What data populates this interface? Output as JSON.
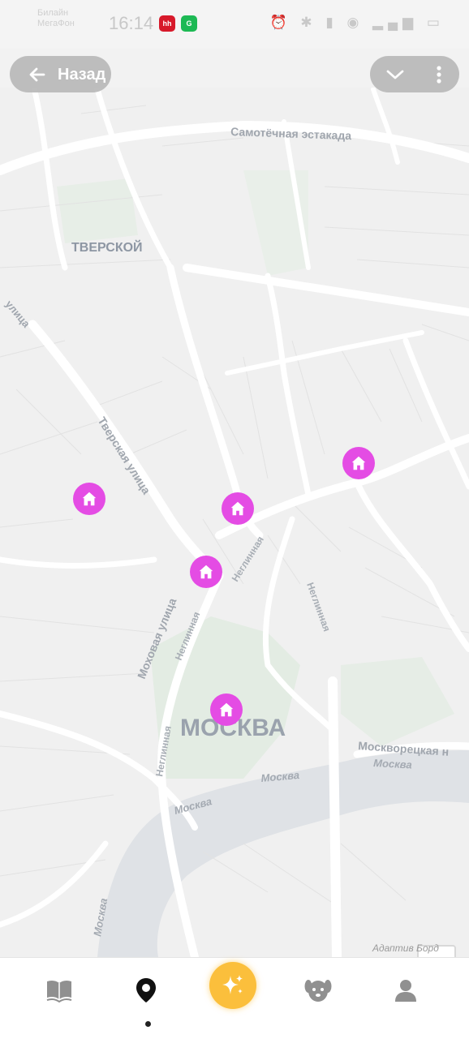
{
  "status_bar": {
    "carrier_line1": "Билайн",
    "carrier_line2": "МегаФон",
    "time": "16:14",
    "app_badges": [
      {
        "icon": "hh-app-icon",
        "text": "hh",
        "color": "#d7192a"
      },
      {
        "icon": "green-app-icon",
        "text": "G",
        "color": "#1db954"
      }
    ],
    "sys_icons": "⏰ ✱ ▮ ◉ ▂▄▆ ▭"
  },
  "header": {
    "back_label": "Назад",
    "back_icon": "arrow-left-icon",
    "collapse_icon": "chevron-down-icon",
    "more_icon": "more-vertical-icon"
  },
  "map": {
    "labels": {
      "district_tverskoy": "ТВЕРСКОЙ",
      "city": "МОСКВА",
      "samotechnaya": "Самотёчная эстакада",
      "tverskaya": "Тверская улица",
      "mokhovaya": "Моховая улица",
      "neglinnaya_1": "Неглинная",
      "neglinnaya_2": "Неглинная",
      "neglinnaya_3": "Неглинная",
      "neglinnaya_4": "Неглинная",
      "ulitsa_left": "улица",
      "moskvoretskaya": "Москворецкая н",
      "moskva_river_1": "Москва",
      "moskva_river_2": "Москва",
      "moskva_river_3": "Москва",
      "moskva_river_4": "Москва"
    },
    "marker_icon": "home-icon",
    "marker_color": "#e44ce4",
    "marker_count": 5,
    "zoom_in": "+",
    "zoom_out": "−",
    "attribution": "Адаптив Борд"
  },
  "bottom_nav": {
    "items": [
      {
        "icon": "book-map-icon",
        "active": false
      },
      {
        "icon": "location-pin-icon",
        "active": true
      },
      {
        "icon": "sparkles-icon",
        "active": false,
        "accent": "#fbbf3c"
      },
      {
        "icon": "dog-icon",
        "active": false
      },
      {
        "icon": "user-icon",
        "active": false
      }
    ]
  }
}
